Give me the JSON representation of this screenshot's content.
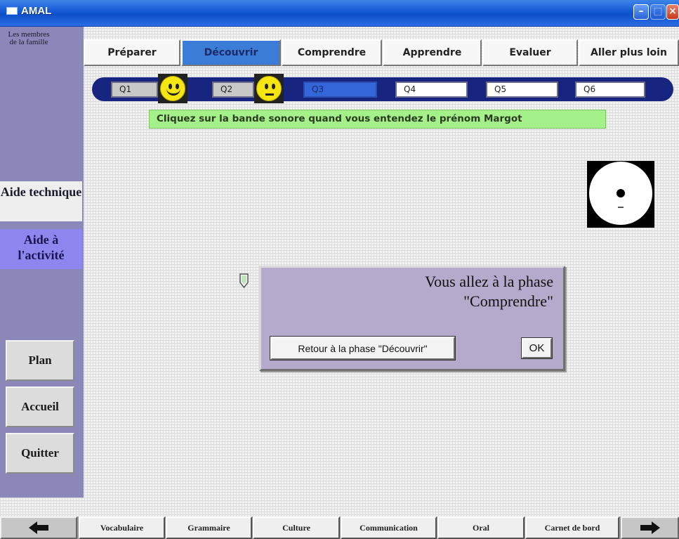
{
  "window": {
    "title": "AMAL"
  },
  "sidebar": {
    "activity_title": "Les membres de la famille",
    "tabs": {
      "aide_technique": "Aide technique",
      "aide_activite": "Aide à l'activité"
    },
    "buttons": {
      "plan": "Plan",
      "accueil": "Accueil",
      "quitter": "Quitter"
    }
  },
  "phases": [
    {
      "label": "Préparer"
    },
    {
      "label": "Découvrir",
      "active": true
    },
    {
      "label": "Comprendre"
    },
    {
      "label": "Apprendre"
    },
    {
      "label": "Evaluer"
    },
    {
      "label": "Aller plus loin"
    }
  ],
  "questions": [
    {
      "label": "Q1",
      "state": "done",
      "feedback": "happy"
    },
    {
      "label": "Q2",
      "state": "done",
      "feedback": "neutral"
    },
    {
      "label": "Q3",
      "state": "current"
    },
    {
      "label": "Q4",
      "state": "pending"
    },
    {
      "label": "Q5",
      "state": "pending"
    },
    {
      "label": "Q6",
      "state": "pending"
    }
  ],
  "instruction": "Cliquez sur la bande sonore quand vous entendez le prénom Margot",
  "dialog": {
    "message": "Vous allez à la phase\n\"Comprendre\"",
    "retour_label": "Retour à la phase \"Découvrir\"",
    "ok_label": "OK"
  },
  "bottom_tabs": [
    "Vocabulaire",
    "Grammaire",
    "Culture",
    "Communication",
    "Oral",
    "Carnet de bord"
  ],
  "icons": {
    "app": "window-icon",
    "soundtrack": "cd-icon",
    "prev": "arrow-left-icon",
    "next": "arrow-right-icon",
    "happy": "smiley-happy-icon",
    "neutral": "smiley-neutral-icon"
  },
  "colors": {
    "titlebar": "#1458d6",
    "sidebar": "#8b87b8",
    "active_phase": "#3a7cd6",
    "question_track": "#172581",
    "instruction_bg": "#a4f08a",
    "dialog_bg": "#b5aacb",
    "smiley": "#f5e612"
  }
}
